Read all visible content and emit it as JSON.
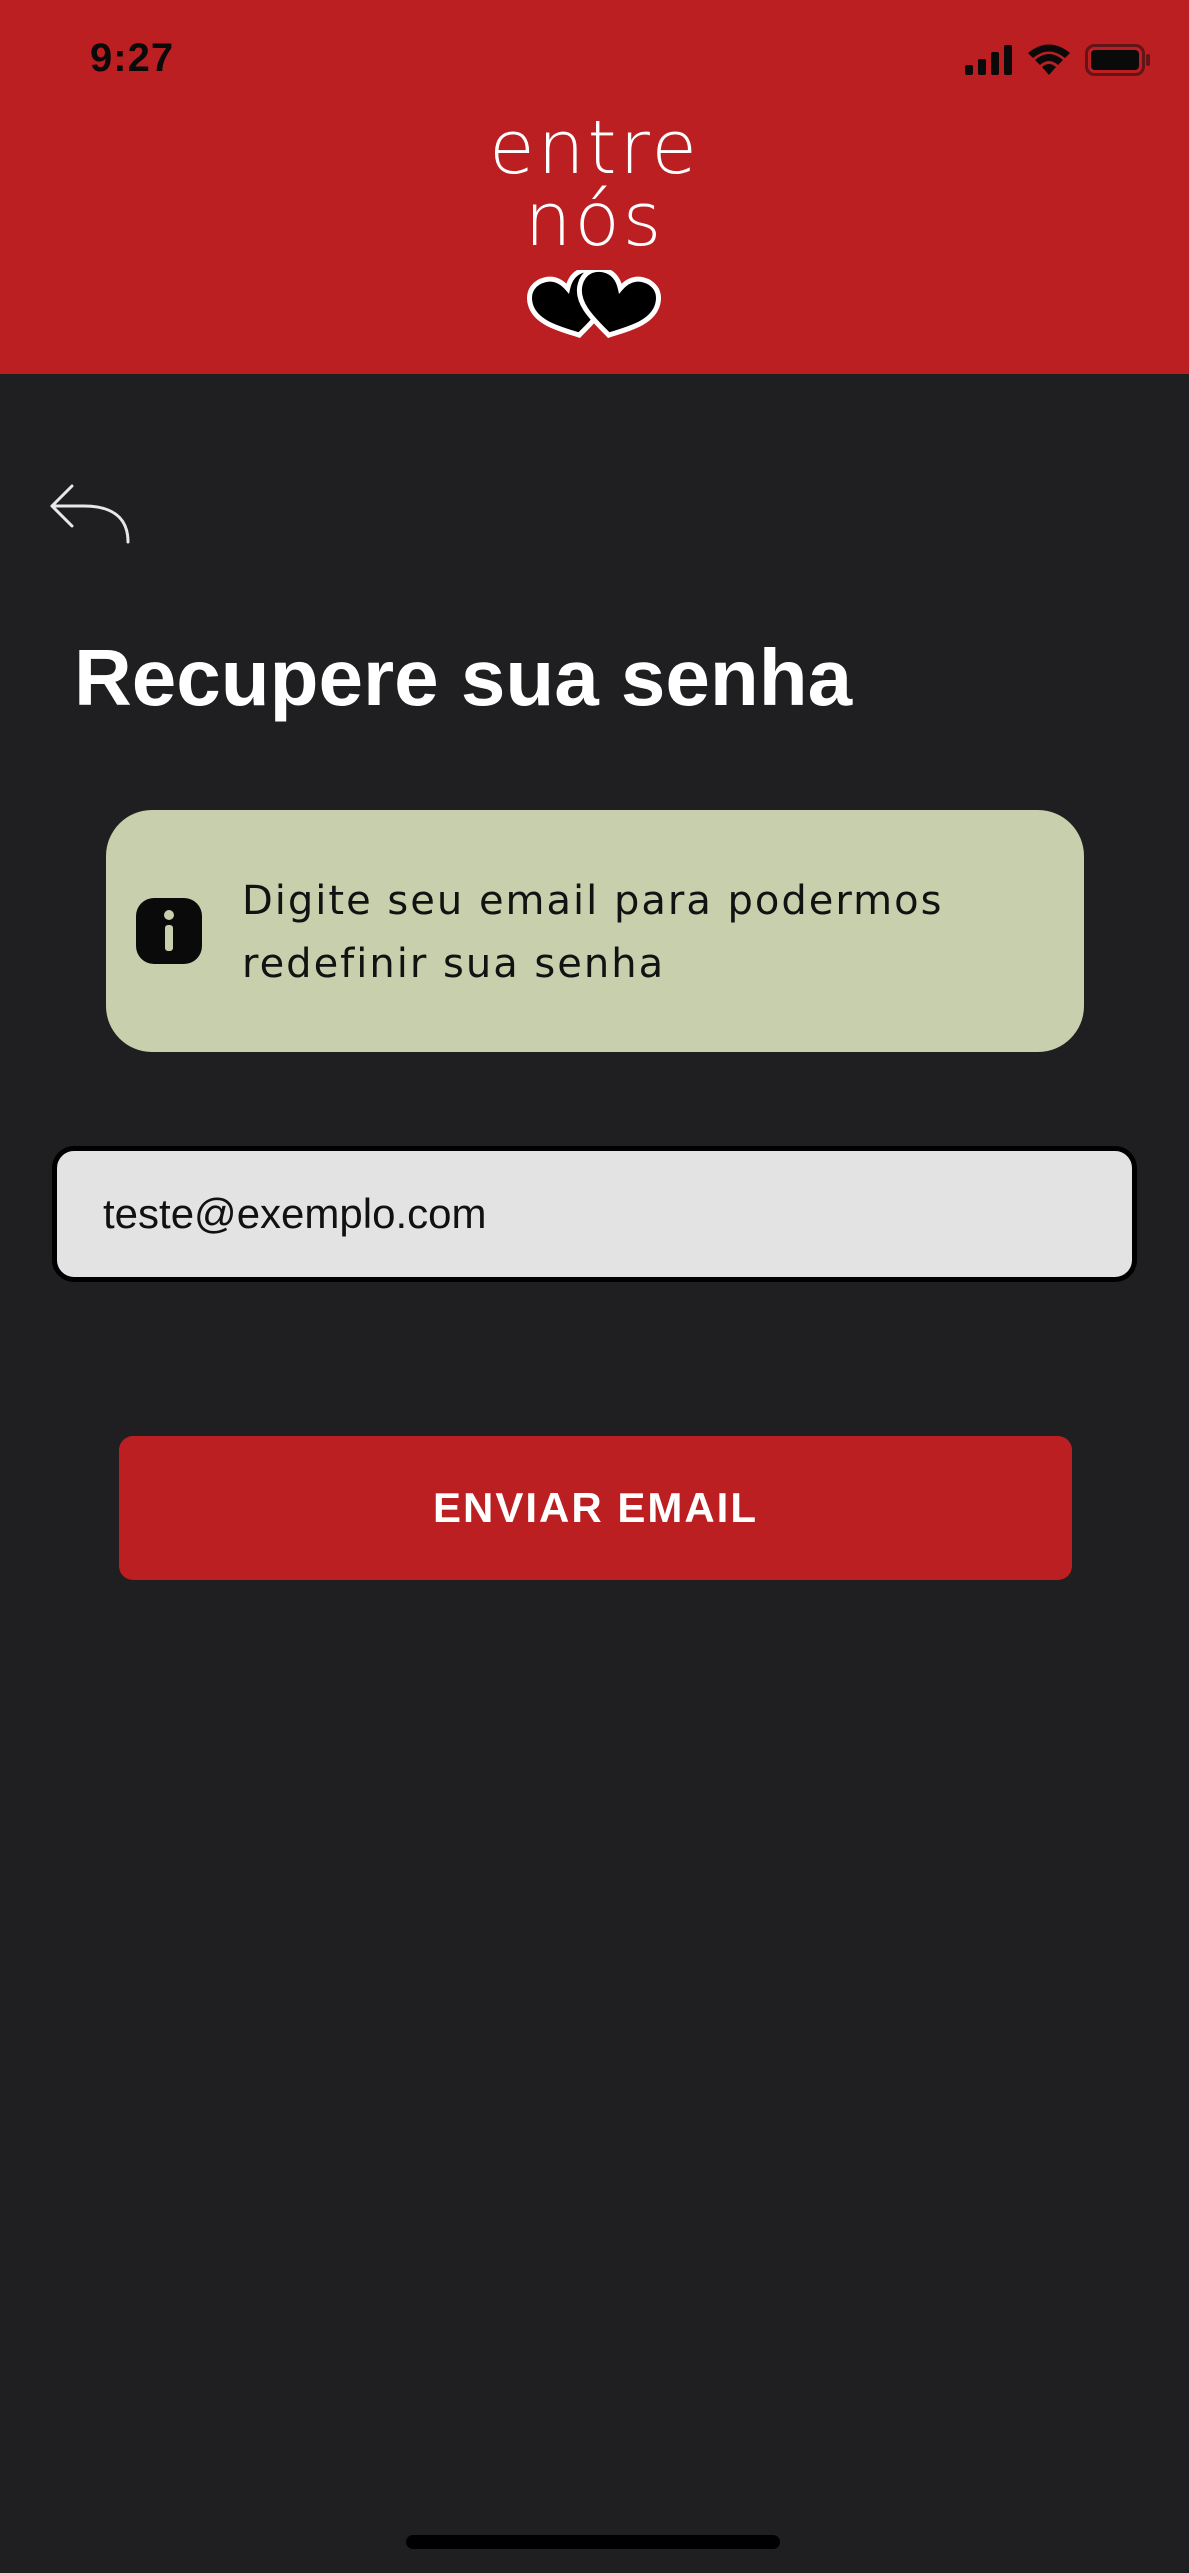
{
  "status_bar": {
    "time": "9:27",
    "icons": [
      "cellular-signal-icon",
      "wifi-icon",
      "battery-icon"
    ]
  },
  "header": {
    "logo_line1": "entre",
    "logo_line2": "nós",
    "logo_icon": "two-hearts-icon"
  },
  "navigation": {
    "back_icon": "back-arrow-icon"
  },
  "main": {
    "title": "Recupere sua senha",
    "info": {
      "icon": "info-icon",
      "text_line1": "Digite seu email para podermos",
      "text_line2": "redefinir sua senha"
    },
    "email_value": "teste@exemplo.com",
    "submit_label": "ENVIAR EMAIL"
  },
  "colors": {
    "brand_red": "#bc1f22",
    "background": "#1f1f21",
    "info_background": "#c8cfad",
    "input_background": "#e3e3e3"
  }
}
